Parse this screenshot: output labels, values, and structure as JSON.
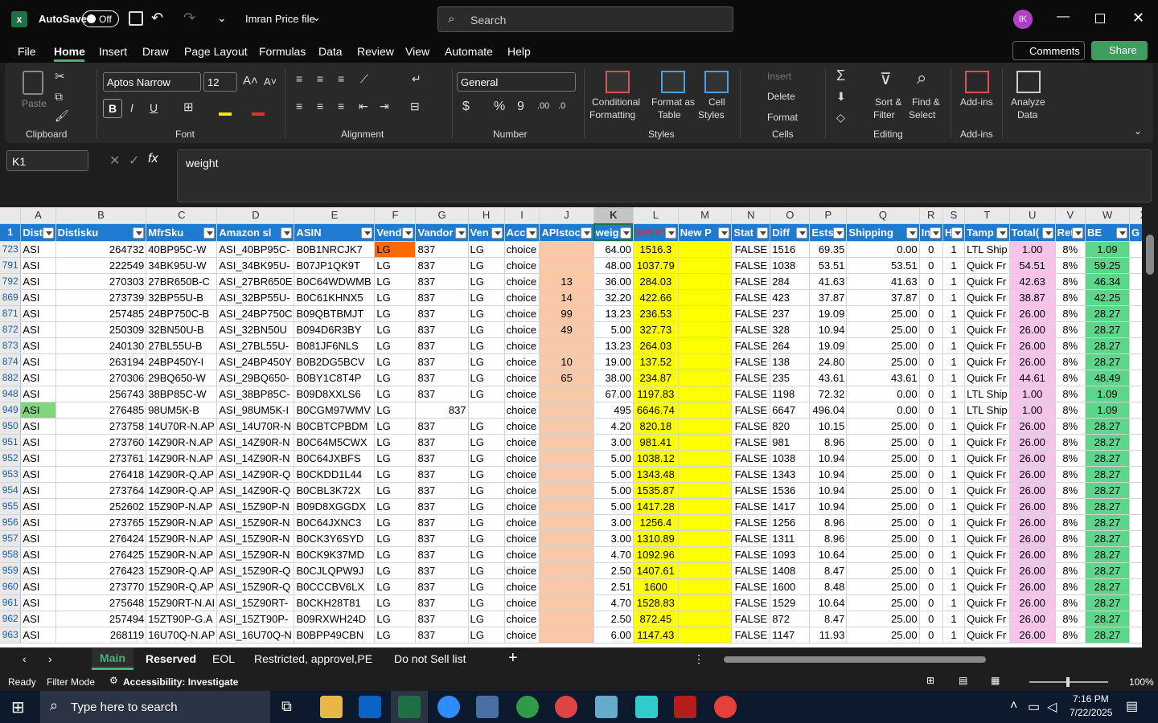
{
  "window": {
    "autosave_label": "AutoSave",
    "autosave_state": "Off",
    "file_name": "Imran Price file",
    "search_placeholder": "Search",
    "user_initials": "IK"
  },
  "tabs": [
    "File",
    "Home",
    "Insert",
    "Draw",
    "Page Layout",
    "Formulas",
    "Data",
    "Review",
    "View",
    "Automate",
    "Help"
  ],
  "tabs_right": {
    "comments": "Comments",
    "share": "Share"
  },
  "ribbon": {
    "clipboard": {
      "paste": "Paste",
      "group": "Clipboard"
    },
    "font": {
      "family": "Aptos Narrow",
      "size": "12",
      "group": "Font"
    },
    "alignment": {
      "group": "Alignment"
    },
    "number": {
      "format": "General",
      "group": "Number"
    },
    "styles": {
      "conditional": "Conditional",
      "conditional2": "Formatting",
      "format_as": "Format as",
      "format_as2": "Table",
      "cell_styles": "Cell",
      "cell_styles2": "Styles",
      "group": "Styles"
    },
    "cells": {
      "insert": "Insert",
      "delete": "Delete",
      "format": "Format",
      "group": "Cells"
    },
    "editing": {
      "sort": "Sort &",
      "sort2": "Filter",
      "find": "Find &",
      "find2": "Select",
      "group": "Editing"
    },
    "addins": {
      "label": "Add-ins",
      "group": "Add-ins"
    },
    "analyze": {
      "label": "Analyze",
      "label2": "Data"
    }
  },
  "formula_bar": {
    "name_box": "K1",
    "content": "weight"
  },
  "columns": [
    "A",
    "B",
    "C",
    "D",
    "E",
    "F",
    "G",
    "H",
    "I",
    "J",
    "K",
    "L",
    "M",
    "N",
    "O",
    "P",
    "Q",
    "R",
    "S",
    "T",
    "U",
    "V",
    "W",
    "X"
  ],
  "headers": [
    "Dist",
    "Distisku",
    "MfrSku",
    "Amazon sl",
    "ASIN",
    "Vend",
    "Vandor",
    "Ven",
    "Acc",
    "APIstoc",
    "weig",
    "API P",
    "New P",
    "Stat",
    "Diff",
    "Ests",
    "Shipping",
    "In",
    "H",
    "Tamp",
    "Total(",
    "Ret",
    "BE",
    "G"
  ],
  "rows": [
    {
      "n": "723",
      "c": [
        "ASI",
        "264732",
        "40BP95C-W",
        "ASI_40BP95C-",
        "B0B1NRCJK7",
        "LG",
        "837",
        "LG",
        "choice",
        "",
        "64.00",
        "1516.3",
        "",
        "FALSE",
        "1516",
        "69.35",
        "0.00",
        "0",
        "1",
        "LTL Ship",
        "1.00",
        "8%",
        "1.09",
        ""
      ]
    },
    {
      "n": "791",
      "c": [
        "ASI",
        "222549",
        "34BK95U-W",
        "ASI_34BK95U-",
        "B07JP1QK9T",
        "LG",
        "837",
        "LG",
        "choice",
        "",
        "48.00",
        "1037.79",
        "",
        "FALSE",
        "1038",
        "53.51",
        "53.51",
        "0",
        "1",
        "Quick Fr",
        "54.51",
        "8%",
        "59.25",
        ""
      ]
    },
    {
      "n": "792",
      "c": [
        "ASI",
        "270303",
        "27BR650B-C",
        "ASI_27BR650E",
        "B0C64WDWMB",
        "LG",
        "837",
        "LG",
        "choice",
        "13",
        "36.00",
        "284.03",
        "",
        "FALSE",
        "284",
        "41.63",
        "41.63",
        "0",
        "1",
        "Quick Fr",
        "42.63",
        "8%",
        "46.34",
        ""
      ]
    },
    {
      "n": "869",
      "c": [
        "ASI",
        "273739",
        "32BP55U-B",
        "ASI_32BP55U-",
        "B0C61KHNX5",
        "LG",
        "837",
        "LG",
        "choice",
        "14",
        "32.20",
        "422.66",
        "",
        "FALSE",
        "423",
        "37.87",
        "37.87",
        "0",
        "1",
        "Quick Fr",
        "38.87",
        "8%",
        "42.25",
        ""
      ]
    },
    {
      "n": "871",
      "c": [
        "ASI",
        "257485",
        "24BP750C-B",
        "ASI_24BP750C",
        "B09QBTBMJT",
        "LG",
        "837",
        "LG",
        "choice",
        "99",
        "13.23",
        "236.53",
        "",
        "FALSE",
        "237",
        "19.09",
        "25.00",
        "0",
        "1",
        "Quick Fr",
        "26.00",
        "8%",
        "28.27",
        ""
      ]
    },
    {
      "n": "872",
      "c": [
        "ASI",
        "250309",
        "32BN50U-B",
        "ASI_32BN50U",
        "B094D6R3BY",
        "LG",
        "837",
        "LG",
        "choice",
        "49",
        "5.00",
        "327.73",
        "",
        "FALSE",
        "328",
        "10.94",
        "25.00",
        "0",
        "1",
        "Quick Fr",
        "26.00",
        "8%",
        "28.27",
        ""
      ]
    },
    {
      "n": "873",
      "c": [
        "ASI",
        "240130",
        "27BL55U-B",
        "ASI_27BL55U-",
        "B081JF6NLS",
        "LG",
        "837",
        "LG",
        "choice",
        "",
        "13.23",
        "264.03",
        "",
        "FALSE",
        "264",
        "19.09",
        "25.00",
        "0",
        "1",
        "Quick Fr",
        "26.00",
        "8%",
        "28.27",
        ""
      ]
    },
    {
      "n": "874",
      "c": [
        "ASI",
        "263194",
        "24BP450Y-I",
        "ASI_24BP450Y",
        "B0B2DG5BCV",
        "LG",
        "837",
        "LG",
        "choice",
        "10",
        "19.00",
        "137.52",
        "",
        "FALSE",
        "138",
        "24.80",
        "25.00",
        "0",
        "1",
        "Quick Fr",
        "26.00",
        "8%",
        "28.27",
        ""
      ]
    },
    {
      "n": "882",
      "c": [
        "ASI",
        "270306",
        "29BQ650-W",
        "ASI_29BQ650-",
        "B0BY1C8T4P",
        "LG",
        "837",
        "LG",
        "choice",
        "65",
        "38.00",
        "234.87",
        "",
        "FALSE",
        "235",
        "43.61",
        "43.61",
        "0",
        "1",
        "Quick Fr",
        "44.61",
        "8%",
        "48.49",
        ""
      ]
    },
    {
      "n": "948",
      "c": [
        "ASI",
        "256743",
        "38BP85C-W",
        "ASI_38BP85C-",
        "B09D8XXLS6",
        "LG",
        "837",
        "LG",
        "choice",
        "",
        "67.00",
        "1197.83",
        "",
        "FALSE",
        "1198",
        "72.32",
        "0.00",
        "0",
        "1",
        "LTL Ship",
        "1.00",
        "8%",
        "1.09",
        ""
      ]
    },
    {
      "n": "949",
      "c": [
        "ASI",
        "276485",
        "98UM5K-B",
        "ASI_98UM5K-I",
        "B0CGM97WMV",
        "LG",
        "837",
        "",
        "choice",
        "",
        "495",
        "6646.74",
        "",
        "FALSE",
        "6647",
        "496.04",
        "0.00",
        "0",
        "1",
        "LTL Ship",
        "1.00",
        "8%",
        "1.09",
        ""
      ]
    },
    {
      "n": "950",
      "c": [
        "ASI",
        "273758",
        "14U70R-N.AP",
        "ASI_14U70R-N",
        "B0CBTCPBDM",
        "LG",
        "837",
        "LG",
        "choice",
        "",
        "4.20",
        "820.18",
        "",
        "FALSE",
        "820",
        "10.15",
        "25.00",
        "0",
        "1",
        "Quick Fr",
        "26.00",
        "8%",
        "28.27",
        ""
      ]
    },
    {
      "n": "951",
      "c": [
        "ASI",
        "273760",
        "14Z90R-N.AP",
        "ASI_14Z90R-N",
        "B0C64M5CWX",
        "LG",
        "837",
        "LG",
        "choice",
        "",
        "3.00",
        "981.41",
        "",
        "FALSE",
        "981",
        "8.96",
        "25.00",
        "0",
        "1",
        "Quick Fr",
        "26.00",
        "8%",
        "28.27",
        ""
      ]
    },
    {
      "n": "952",
      "c": [
        "ASI",
        "273761",
        "14Z90R-N.AP",
        "ASI_14Z90R-N",
        "B0C64JXBFS",
        "LG",
        "837",
        "LG",
        "choice",
        "",
        "5.00",
        "1038.12",
        "",
        "FALSE",
        "1038",
        "10.94",
        "25.00",
        "0",
        "1",
        "Quick Fr",
        "26.00",
        "8%",
        "28.27",
        ""
      ]
    },
    {
      "n": "953",
      "c": [
        "ASI",
        "276418",
        "14Z90R-Q.AP",
        "ASI_14Z90R-Q",
        "B0CKDD1L44",
        "LG",
        "837",
        "LG",
        "choice",
        "",
        "5.00",
        "1343.48",
        "",
        "FALSE",
        "1343",
        "10.94",
        "25.00",
        "0",
        "1",
        "Quick Fr",
        "26.00",
        "8%",
        "28.27",
        ""
      ]
    },
    {
      "n": "954",
      "c": [
        "ASI",
        "273764",
        "14Z90R-Q.AP",
        "ASI_14Z90R-Q",
        "B0CBL3K72X",
        "LG",
        "837",
        "LG",
        "choice",
        "",
        "5.00",
        "1535.87",
        "",
        "FALSE",
        "1536",
        "10.94",
        "25.00",
        "0",
        "1",
        "Quick Fr",
        "26.00",
        "8%",
        "28.27",
        ""
      ]
    },
    {
      "n": "955",
      "c": [
        "ASI",
        "252602",
        "15Z90P-N.AP",
        "ASI_15Z90P-N",
        "B09D8XGGDX",
        "LG",
        "837",
        "LG",
        "choice",
        "",
        "5.00",
        "1417.28",
        "",
        "FALSE",
        "1417",
        "10.94",
        "25.00",
        "0",
        "1",
        "Quick Fr",
        "26.00",
        "8%",
        "28.27",
        ""
      ]
    },
    {
      "n": "956",
      "c": [
        "ASI",
        "273765",
        "15Z90R-N.AP",
        "ASI_15Z90R-N",
        "B0C64JXNC3",
        "LG",
        "837",
        "LG",
        "choice",
        "",
        "3.00",
        "1256.4",
        "",
        "FALSE",
        "1256",
        "8.96",
        "25.00",
        "0",
        "1",
        "Quick Fr",
        "26.00",
        "8%",
        "28.27",
        ""
      ]
    },
    {
      "n": "957",
      "c": [
        "ASI",
        "276424",
        "15Z90R-N.AP",
        "ASI_15Z90R-N",
        "B0CK3Y6SYD",
        "LG",
        "837",
        "LG",
        "choice",
        "",
        "3.00",
        "1310.89",
        "",
        "FALSE",
        "1311",
        "8.96",
        "25.00",
        "0",
        "1",
        "Quick Fr",
        "26.00",
        "8%",
        "28.27",
        ""
      ]
    },
    {
      "n": "958",
      "c": [
        "ASI",
        "276425",
        "15Z90R-N.AP",
        "ASI_15Z90R-N",
        "B0CK9K37MD",
        "LG",
        "837",
        "LG",
        "choice",
        "",
        "4.70",
        "1092.96",
        "",
        "FALSE",
        "1093",
        "10.64",
        "25.00",
        "0",
        "1",
        "Quick Fr",
        "26.00",
        "8%",
        "28.27",
        ""
      ]
    },
    {
      "n": "959",
      "c": [
        "ASI",
        "276423",
        "15Z90R-Q.AP",
        "ASI_15Z90R-Q",
        "B0CJLQPW9J",
        "LG",
        "837",
        "LG",
        "choice",
        "",
        "2.50",
        "1407.61",
        "",
        "FALSE",
        "1408",
        "8.47",
        "25.00",
        "0",
        "1",
        "Quick Fr",
        "26.00",
        "8%",
        "28.27",
        ""
      ]
    },
    {
      "n": "960",
      "c": [
        "ASI",
        "273770",
        "15Z90R-Q.AP",
        "ASI_15Z90R-Q",
        "B0CCCBV6LX",
        "LG",
        "837",
        "LG",
        "choice",
        "",
        "2.51",
        "1600",
        "",
        "FALSE",
        "1600",
        "8.48",
        "25.00",
        "0",
        "1",
        "Quick Fr",
        "26.00",
        "8%",
        "28.27",
        ""
      ]
    },
    {
      "n": "961",
      "c": [
        "ASI",
        "275648",
        "15Z90RT-N.AI",
        "ASI_15Z90RT-",
        "B0CKH28T81",
        "LG",
        "837",
        "LG",
        "choice",
        "",
        "4.70",
        "1528.83",
        "",
        "FALSE",
        "1529",
        "10.64",
        "25.00",
        "0",
        "1",
        "Quick Fr",
        "26.00",
        "8%",
        "28.27",
        ""
      ]
    },
    {
      "n": "962",
      "c": [
        "ASI",
        "257494",
        "15ZT90P-G.A",
        "ASI_15ZT90P-",
        "B09RXWH24D",
        "LG",
        "837",
        "LG",
        "choice",
        "",
        "2.50",
        "872.45",
        "",
        "FALSE",
        "872",
        "8.47",
        "25.00",
        "0",
        "1",
        "Quick Fr",
        "26.00",
        "8%",
        "28.27",
        ""
      ]
    },
    {
      "n": "963",
      "c": [
        "ASI",
        "268119",
        "16U70Q-N.AP",
        "ASI_16U70Q-N",
        "B0BPP49CBN",
        "LG",
        "837",
        "LG",
        "choice",
        "",
        "6.00",
        "1147.43",
        "",
        "FALSE",
        "1147",
        "11.93",
        "25.00",
        "0",
        "1",
        "Quick Fr",
        "26.00",
        "8%",
        "28.27",
        ""
      ]
    }
  ],
  "sheets": [
    "Main",
    "Reserved",
    "EOL",
    "Restricted, approvel,PE",
    "Do not Sell list"
  ],
  "status": {
    "ready": "Ready",
    "filter": "Filter Mode",
    "accessibility": "Accessibility: Investigate",
    "zoom": "100%"
  },
  "taskbar": {
    "search": "Type here to search",
    "time": "7:16 PM",
    "date": "7/22/2025"
  }
}
